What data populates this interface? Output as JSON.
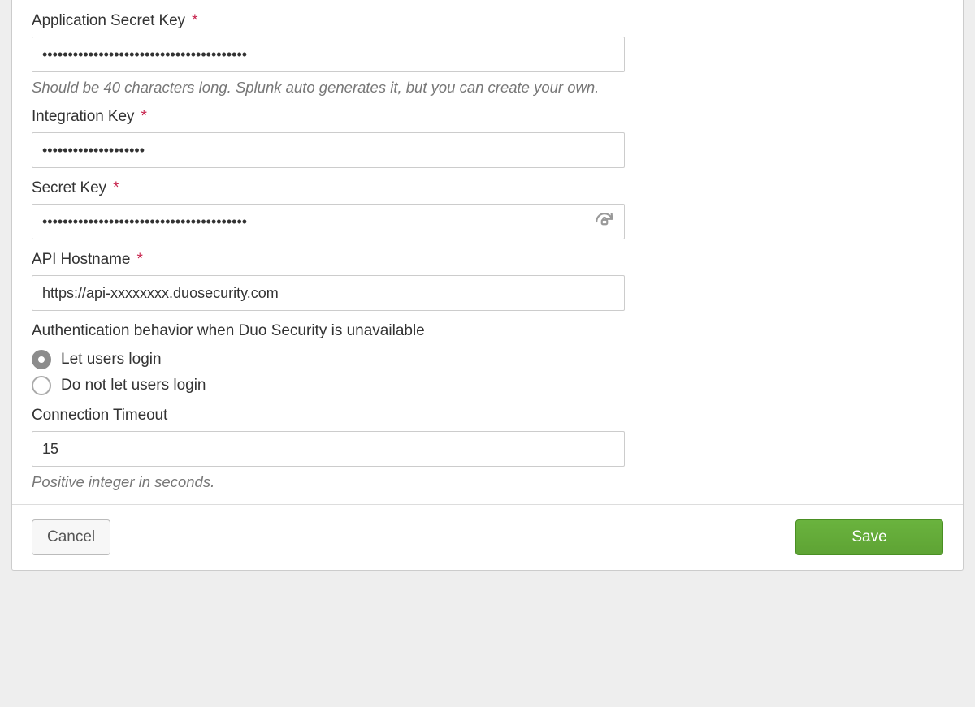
{
  "form": {
    "app_secret": {
      "label": "Application Secret Key",
      "value": "••••••••••••••••••••••••••••••••••••••••",
      "help": "Should be 40 characters long. Splunk auto generates it, but you can create your own.",
      "required": true
    },
    "integration_key": {
      "label": "Integration Key",
      "value": "••••••••••••••••••••",
      "required": true
    },
    "secret_key": {
      "label": "Secret Key",
      "value": "••••••••••••••••••••••••••••••••••••••••",
      "required": true
    },
    "api_hostname": {
      "label": "API Hostname",
      "value": "https://api-xxxxxxxx.duosecurity.com",
      "required": true
    },
    "auth_behavior": {
      "label": "Authentication behavior when Duo Security is unavailable",
      "options": [
        {
          "label": "Let users login",
          "value": "allow",
          "checked": true
        },
        {
          "label": "Do not let users login",
          "value": "deny",
          "checked": false
        }
      ]
    },
    "timeout": {
      "label": "Connection Timeout",
      "value": "15",
      "help": "Positive integer in seconds."
    }
  },
  "required_marker": "*",
  "buttons": {
    "cancel": "Cancel",
    "save": "Save"
  },
  "colors": {
    "accent": "#5ea334",
    "border": "#cccccc",
    "required": "#c7254e"
  }
}
